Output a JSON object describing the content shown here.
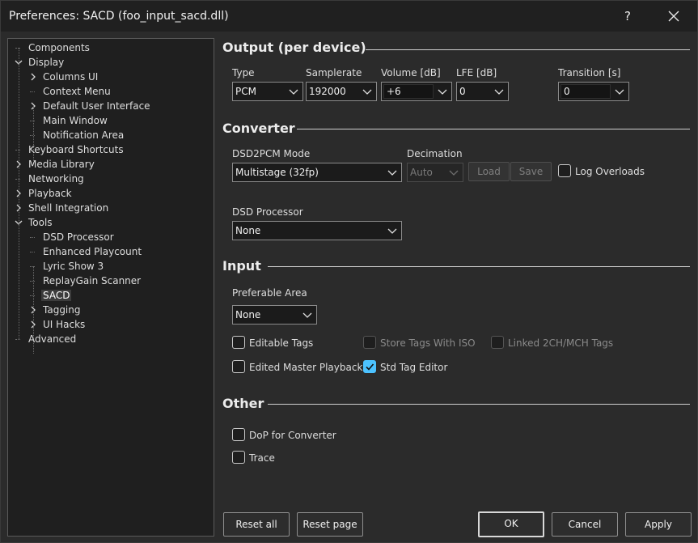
{
  "window": {
    "title": "Preferences: SACD (foo_input_sacd.dll)",
    "help_glyph": "?"
  },
  "tree": {
    "items": [
      {
        "label": "Components",
        "expander": "none"
      },
      {
        "label": "Display",
        "expander": "expanded"
      },
      {
        "label": "Columns UI",
        "expander": "collapsed"
      },
      {
        "label": "Context Menu",
        "expander": "none"
      },
      {
        "label": "Default User Interface",
        "expander": "collapsed"
      },
      {
        "label": "Main Window",
        "expander": "none"
      },
      {
        "label": "Notification Area",
        "expander": "none"
      },
      {
        "label": "Keyboard Shortcuts",
        "expander": "none"
      },
      {
        "label": "Media Library",
        "expander": "collapsed"
      },
      {
        "label": "Networking",
        "expander": "none"
      },
      {
        "label": "Playback",
        "expander": "collapsed"
      },
      {
        "label": "Shell Integration",
        "expander": "collapsed"
      },
      {
        "label": "Tools",
        "expander": "expanded"
      },
      {
        "label": "DSD Processor",
        "expander": "none"
      },
      {
        "label": "Enhanced Playcount",
        "expander": "none"
      },
      {
        "label": "Lyric Show 3",
        "expander": "none"
      },
      {
        "label": "ReplayGain Scanner",
        "expander": "none"
      },
      {
        "label": "SACD",
        "expander": "none",
        "selected": true
      },
      {
        "label": "Tagging",
        "expander": "collapsed"
      },
      {
        "label": "UI Hacks",
        "expander": "collapsed"
      },
      {
        "label": "Advanced",
        "expander": "none"
      }
    ]
  },
  "output": {
    "heading": "Output (per device)",
    "type": {
      "label": "Type",
      "value": "PCM"
    },
    "samplerate": {
      "label": "Samplerate",
      "value": "192000"
    },
    "volume": {
      "label": "Volume [dB]",
      "value": "+6"
    },
    "lfe": {
      "label": "LFE [dB]",
      "value": "0"
    },
    "transition": {
      "label": "Transition [s]",
      "value": "0"
    }
  },
  "converter": {
    "heading": "Converter",
    "mode": {
      "label": "DSD2PCM Mode",
      "value": "Multistage (32fp)"
    },
    "decimation": {
      "label": "Decimation",
      "value": "Auto"
    },
    "load_label": "Load",
    "save_label": "Save",
    "log_overloads": {
      "label": "Log Overloads",
      "checked": false
    },
    "processor": {
      "label": "DSD Processor",
      "value": "None"
    }
  },
  "input": {
    "heading": "Input",
    "area": {
      "label": "Preferable Area",
      "value": "None"
    },
    "editable_tags": {
      "label": "Editable Tags",
      "checked": false
    },
    "store_tags_iso": {
      "label": "Store Tags With ISO",
      "checked": false,
      "disabled": true
    },
    "linked_tags": {
      "label": "Linked 2CH/MCH Tags",
      "checked": false,
      "disabled": true
    },
    "edited_master": {
      "label": "Edited Master Playback",
      "checked": false
    },
    "std_tag_editor": {
      "label": "Std Tag Editor",
      "checked": true
    }
  },
  "other": {
    "heading": "Other",
    "dop": {
      "label": "DoP for Converter",
      "checked": false
    },
    "trace": {
      "label": "Trace",
      "checked": false
    }
  },
  "footer": {
    "reset_all": "Reset all",
    "reset_page": "Reset page",
    "ok": "OK",
    "cancel": "Cancel",
    "apply": "Apply"
  },
  "colors": {
    "accent": "#4cc2ff",
    "background": "#2b2b2b",
    "titlebar": "#202020"
  }
}
